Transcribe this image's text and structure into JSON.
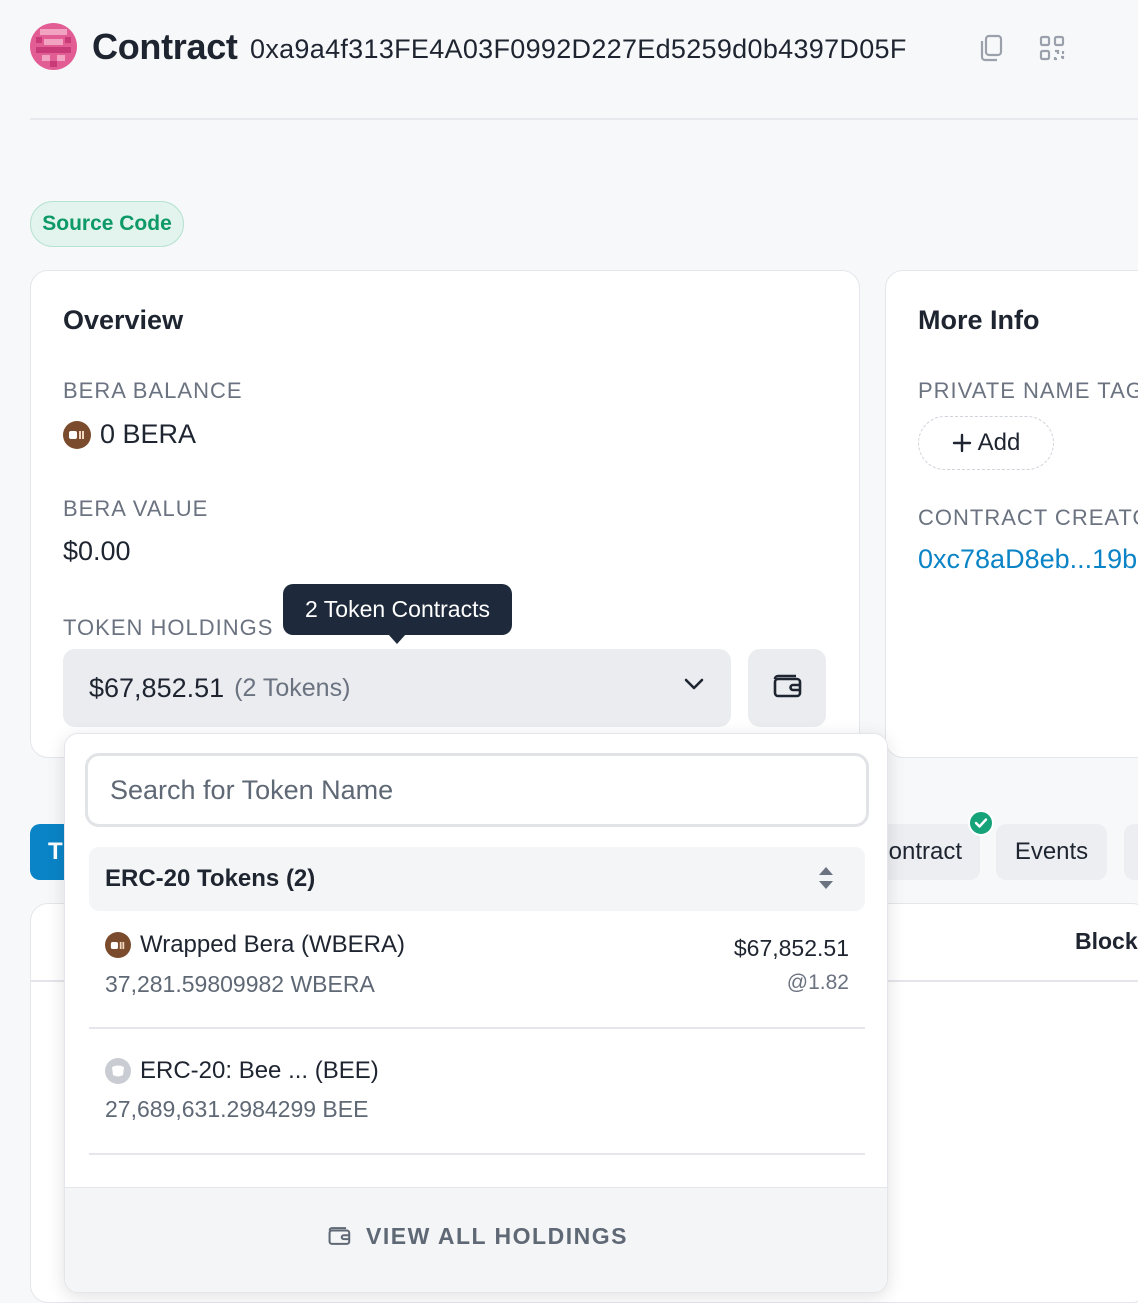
{
  "header": {
    "title": "Contract",
    "address": "0xa9a4f313FE4A03F0992D227Ed5259d0b4397D05F",
    "copy_icon": "copy-icon",
    "qr_icon": "qr-code-icon"
  },
  "badge": {
    "label": "Source Code"
  },
  "overview": {
    "title": "Overview",
    "balance_label": "BERA BALANCE",
    "balance_value": "0 BERA",
    "value_label": "BERA VALUE",
    "value_value": "$0.00",
    "holdings_label": "TOKEN HOLDINGS",
    "holdings_amount": "$67,852.51",
    "holdings_count": "(2 Tokens)",
    "tooltip": "2 Token Contracts"
  },
  "more_info": {
    "title": "More Info",
    "name_tag_label": "PRIVATE NAME TAG",
    "add_label": "Add",
    "creator_label": "CONTRACT CREATOR",
    "creator_value": "0xc78aD8eb...19b"
  },
  "tabs": {
    "active_label": "T",
    "contract_label": "ontract",
    "events_label": "Events"
  },
  "table": {
    "block_header": "Block"
  },
  "dropdown": {
    "search_placeholder": "Search for Token Name",
    "group_label": "ERC-20 Tokens (2)",
    "tokens": [
      {
        "name": "Wrapped Bera (WBERA)",
        "amount": "37,281.59809982 WBERA",
        "value": "$67,852.51",
        "rate": "@1.82",
        "icon": "bera-token-icon"
      },
      {
        "name": "ERC-20: Bee ... (BEE)",
        "amount": "27,689,631.2984299 BEE",
        "value": "",
        "rate": "",
        "icon": "generic-token-icon"
      }
    ],
    "view_all": "VIEW ALL HOLDINGS"
  },
  "colors": {
    "accent": "#0a84c6",
    "badge_green": "#0d9968",
    "tooltip_bg": "#1e2a3b",
    "bera_brown": "#7a4b2c"
  }
}
